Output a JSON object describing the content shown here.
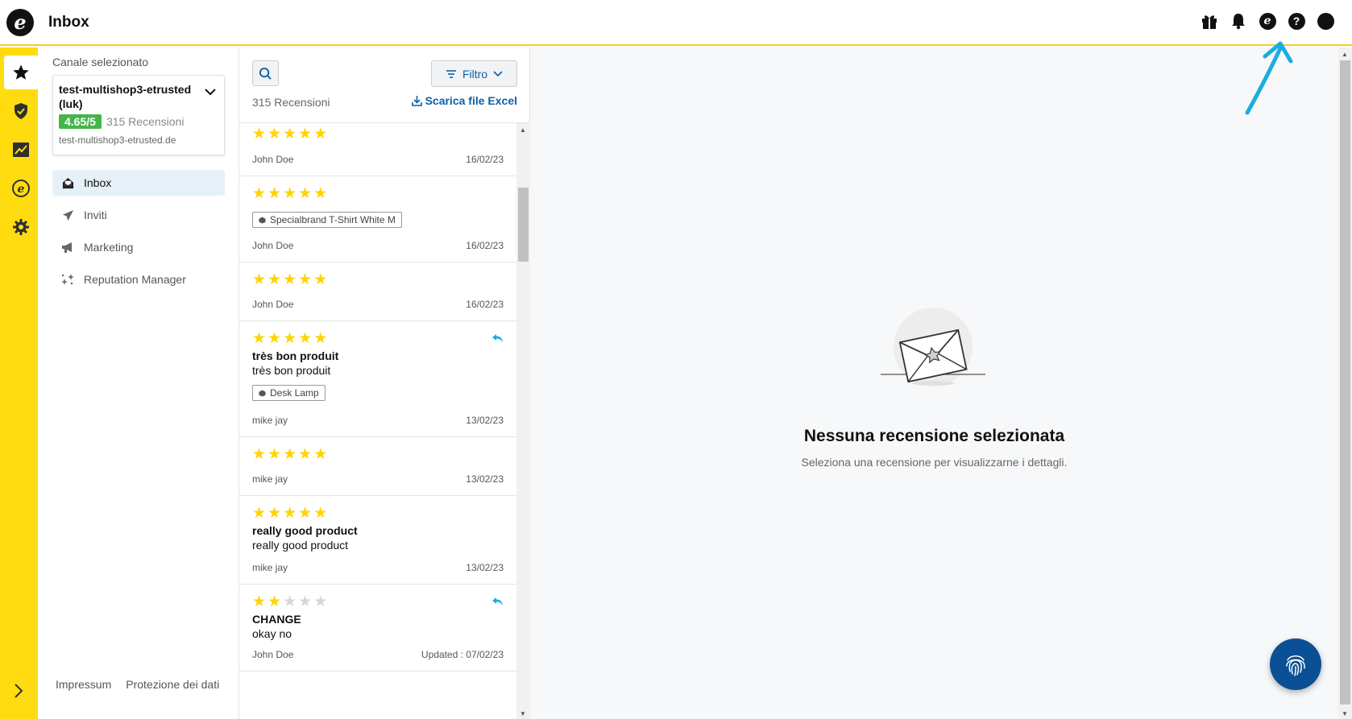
{
  "app": {
    "title": "Inbox"
  },
  "topbar": {
    "icons": [
      "gift-icon",
      "bell-icon",
      "etrusted-icon",
      "help-icon",
      "profile-icon"
    ]
  },
  "rail": {
    "items": [
      "reviews-star-icon",
      "trust-shield-icon",
      "analytics-chart-icon",
      "etrusted-icon",
      "settings-gear-icon"
    ]
  },
  "sidebar": {
    "channel_caption": "Canale selezionato",
    "channel": {
      "name": "test-multishop3-etrusted (luk)",
      "rating": "4.65/5",
      "review_count": "315 Recensioni",
      "domain": "test-multishop3-etrusted.de"
    },
    "nav": [
      {
        "label": "Inbox",
        "icon": "inbox-icon"
      },
      {
        "label": "Inviti",
        "icon": "send-icon"
      },
      {
        "label": "Marketing",
        "icon": "megaphone-icon"
      },
      {
        "label": "Reputation Manager",
        "icon": "sparkle-icon"
      }
    ],
    "footer": {
      "impressum": "Impressum",
      "privacy": "Protezione dei dati"
    }
  },
  "list": {
    "filter_label": "Filtro",
    "count": "315 Recensioni",
    "excel_label": "Scarica file Excel",
    "reviews": [
      {
        "stars": 5,
        "author": "John Doe",
        "date": "16/02/23"
      },
      {
        "stars": 5,
        "tag": "Specialbrand T-Shirt White M",
        "author": "John Doe",
        "date": "16/02/23"
      },
      {
        "stars": 5,
        "author": "John Doe",
        "date": "16/02/23"
      },
      {
        "stars": 5,
        "title": "très bon produit",
        "text": "très bon produit",
        "tag": "Desk Lamp",
        "author": "mike jay",
        "date": "13/02/23",
        "replied": true
      },
      {
        "stars": 5,
        "author": "mike jay",
        "date": "13/02/23"
      },
      {
        "stars": 5,
        "title": "really good product",
        "text": "really good product",
        "author": "mike jay",
        "date": "13/02/23"
      },
      {
        "stars": 2,
        "title": "CHANGE",
        "text": "okay no",
        "author": "John Doe",
        "date": "Updated : 07/02/23",
        "replied": true
      }
    ]
  },
  "detail": {
    "empty_title": "Nessuna recensione selezionata",
    "empty_subtitle": "Seleziona una recensione per visualizzarne i dettagli."
  },
  "colors": {
    "accent_yellow": "#ffdc0f",
    "link_blue": "#0d5fa8",
    "rating_green": "#43b649",
    "star_yellow": "#ffd400",
    "annotation_cyan": "#1aaee0"
  }
}
